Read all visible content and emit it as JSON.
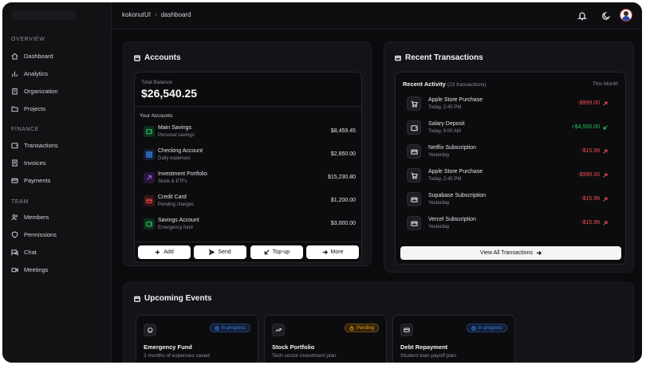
{
  "sidebar": {
    "sections": [
      {
        "title": "OVERVIEW",
        "items": [
          {
            "label": "Dashboard",
            "icon": "home-icon"
          },
          {
            "label": "Analytics",
            "icon": "bar-chart-icon"
          },
          {
            "label": "Organization",
            "icon": "building-icon"
          },
          {
            "label": "Projects",
            "icon": "folder-icon"
          }
        ]
      },
      {
        "title": "FINANCE",
        "items": [
          {
            "label": "Transactions",
            "icon": "wallet-icon"
          },
          {
            "label": "Invoices",
            "icon": "receipt-icon"
          },
          {
            "label": "Payments",
            "icon": "credit-card-icon"
          }
        ]
      },
      {
        "title": "TEAM",
        "items": [
          {
            "label": "Members",
            "icon": "users-icon"
          },
          {
            "label": "Permissions",
            "icon": "shield-icon"
          },
          {
            "label": "Chat",
            "icon": "chat-icon"
          },
          {
            "label": "Meetings",
            "icon": "video-icon"
          }
        ]
      }
    ]
  },
  "header": {
    "breadcrumb": [
      "kokonutUI",
      "dashboard"
    ],
    "icons": [
      "bell-icon",
      "moon-icon",
      "avatar"
    ]
  },
  "accounts": {
    "title": "Accounts",
    "total_label": "Total Balance",
    "total_value": "$26,540.25",
    "list_title": "Your Accounts",
    "items": [
      {
        "name": "Main Savings",
        "sub": "Personal savings",
        "amount": "$8,459.45",
        "icon": "wallet-icon",
        "color": "#22c55e"
      },
      {
        "name": "Checking Account",
        "sub": "Daily expenses",
        "amount": "$2,850.00",
        "icon": "qr-icon",
        "color": "#3b82f6"
      },
      {
        "name": "Investment Portfolio",
        "sub": "Stock & ETFs",
        "amount": "$15,230.80",
        "icon": "arrow-up-right-icon",
        "color": "#a855f7"
      },
      {
        "name": "Credit Card",
        "sub": "Pending charges",
        "amount": "$1,200.00",
        "icon": "credit-card-icon",
        "color": "#ef4444"
      },
      {
        "name": "Savings Account",
        "sub": "Emergency fund",
        "amount": "$3,000.00",
        "icon": "wallet-icon",
        "color": "#22c55e"
      }
    ],
    "buttons": [
      {
        "label": "Add",
        "icon": "plus-icon"
      },
      {
        "label": "Send",
        "icon": "send-icon"
      },
      {
        "label": "Top-up",
        "icon": "arrow-down-left-icon"
      },
      {
        "label": "More",
        "icon": "arrow-right-icon"
      }
    ]
  },
  "transactions": {
    "title": "Recent Transactions",
    "activity_label": "Recent Activity",
    "activity_count": "(23 transactions)",
    "period": "This Month",
    "items": [
      {
        "name": "Apple Store Purchase",
        "time": "Today, 2:45 PM",
        "amount": "-$999.00",
        "type": "debit",
        "icon": "cart-icon"
      },
      {
        "name": "Salary Deposit",
        "time": "Today, 9:00 AM",
        "amount": "+$4,500.00",
        "type": "credit",
        "icon": "wallet-icon"
      },
      {
        "name": "Netflix Subscription",
        "time": "Yesterday",
        "amount": "-$15.99",
        "type": "debit",
        "icon": "card-icon"
      },
      {
        "name": "Apple Store Purchase",
        "time": "Today, 2:45 PM",
        "amount": "-$999.00",
        "type": "debit",
        "icon": "cart-icon"
      },
      {
        "name": "Supabase Subscription",
        "time": "Yesterday",
        "amount": "-$15.99",
        "type": "debit",
        "icon": "card-icon"
      },
      {
        "name": "Vercel Subscription",
        "time": "Yesterday",
        "amount": "-$15.99",
        "type": "debit",
        "icon": "card-icon"
      }
    ],
    "view_all_label": "View All Transactions"
  },
  "events": {
    "title": "Upcoming Events",
    "items": [
      {
        "name": "Emergency Fund",
        "sub": "3 months of expenses saved",
        "status": "In-progress",
        "icon": "piggy-bank-icon"
      },
      {
        "name": "Stock Portfolio",
        "sub": "Tech sector investment plan",
        "status": "Pending",
        "icon": "trending-up-icon"
      },
      {
        "name": "Debt Repayment",
        "sub": "Student loan payoff plan",
        "status": "In-progress",
        "icon": "card-icon"
      }
    ]
  },
  "colors": {
    "debit": "#f05252",
    "credit": "#22c55e",
    "in_progress": "#3b82f6",
    "pending": "#f59e0b"
  }
}
